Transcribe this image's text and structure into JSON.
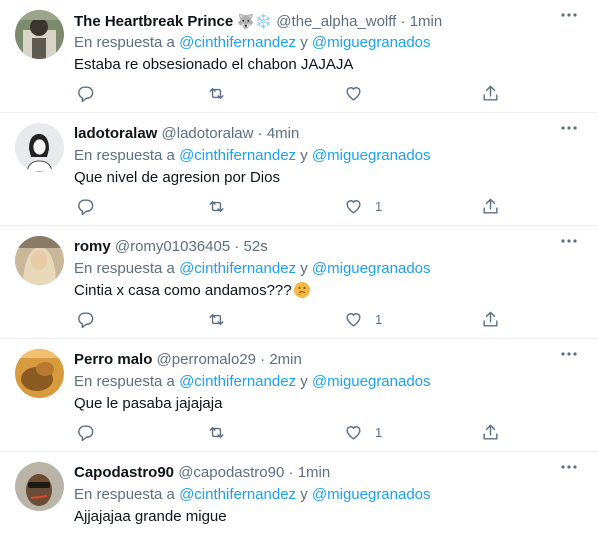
{
  "reply_prefix": "En respuesta a",
  "reply_joiner": "y",
  "mention_1": "@cinthifernandez",
  "mention_2": "@miguegranados",
  "tweets": [
    {
      "name": "The Heartbreak Prince",
      "flair": "🐺❄️",
      "handle": "@the_alpha_wolff",
      "time": "1min",
      "text": "Estaba re obsesionado el chabon JAJAJA",
      "likes": ""
    },
    {
      "name": "ladotoralaw",
      "flair": "",
      "handle": "@ladotoralaw",
      "time": "4min",
      "text": "Que nivel de agresion por Dios",
      "likes": "1"
    },
    {
      "name": "romy",
      "flair": "",
      "handle": "@romy01036405",
      "time": "52s",
      "text": "Cintia x casa como andamos???",
      "likes": "1"
    },
    {
      "name": "Perro malo",
      "flair": "",
      "handle": "@perromalo29",
      "time": "2min",
      "text": "Que le pasaba jajajaja",
      "likes": "1"
    },
    {
      "name": "Capodastro90",
      "flair": "",
      "handle": "@capodastro90",
      "time": "1min",
      "text": "Ajjajajaa grande migue",
      "likes": ""
    }
  ],
  "separator": "·",
  "icons": {
    "reply": "reply-icon",
    "retweet": "retweet-icon",
    "like": "like-icon",
    "share": "share-icon",
    "more": "more-icon"
  },
  "colors": {
    "link": "#1da1f2",
    "secondary": "#5b7083",
    "border": "#ebeef0"
  }
}
